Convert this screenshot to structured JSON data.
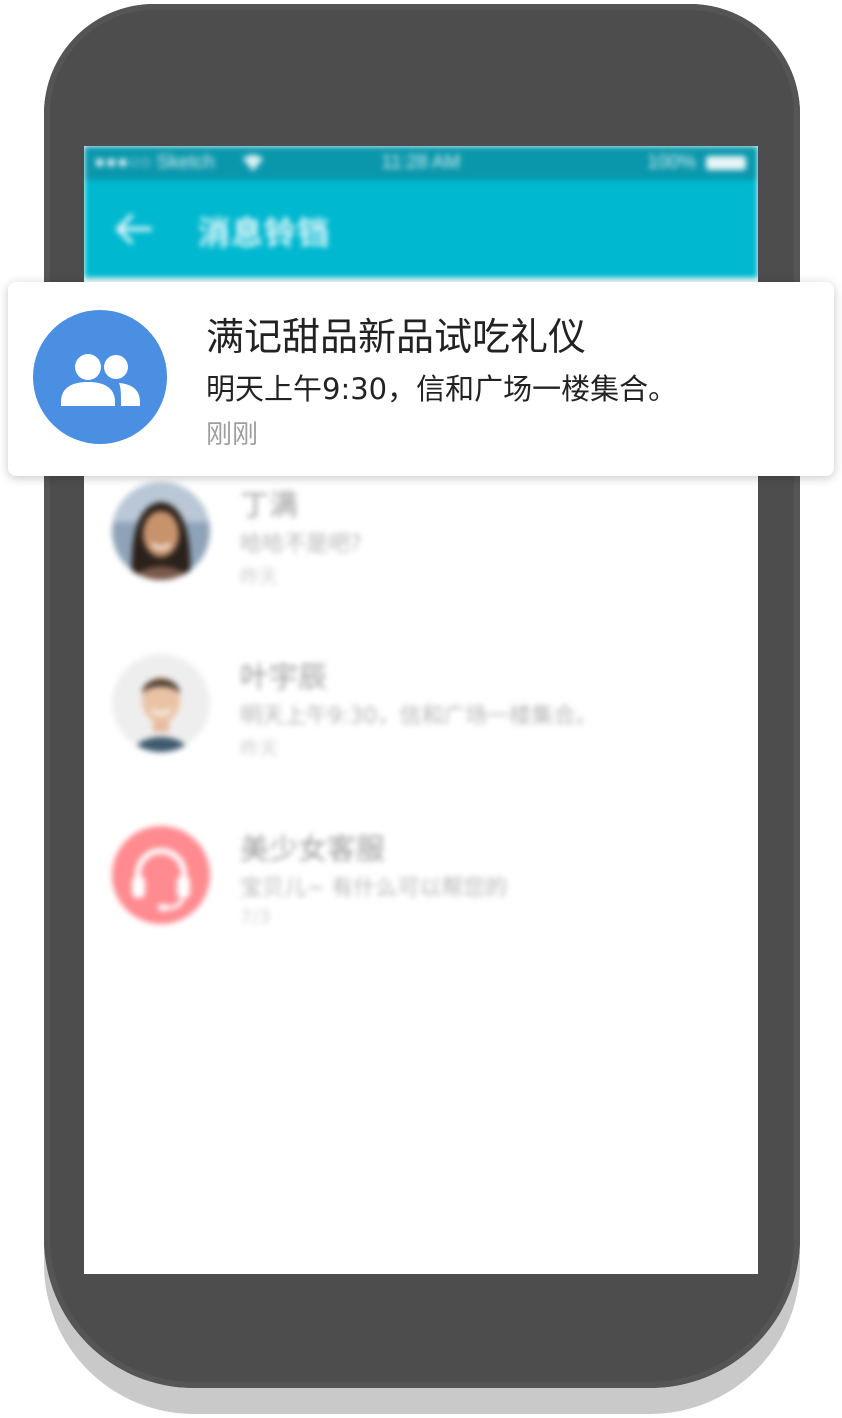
{
  "status_bar": {
    "carrier": "●●●○○ Sketch",
    "time": "11:28 AM",
    "battery": "100%"
  },
  "app_bar": {
    "title": "消息铃铛"
  },
  "notification": {
    "icon": "group-icon",
    "title": "满记甜品新品试吃礼仪",
    "body": "明天上午9:30，信和广场一楼集合。",
    "time": "刚刚"
  },
  "conversations": [
    {
      "name": "丁满",
      "message": "哈哈不是吧?",
      "time": "昨天",
      "avatar": "woman-photo"
    },
    {
      "name": "叶宇辰",
      "message": "明天上午9:30，信和广场一楼集合。",
      "time": "昨天",
      "avatar": "man-photo"
    },
    {
      "name": "美少女客服",
      "message": "宝贝儿~ 有什么可以帮您的",
      "time": "7/3",
      "avatar": "headset-icon"
    }
  ],
  "colors": {
    "phone_body": "#4d4d4d",
    "status_bar": "#0a97ac",
    "app_bar": "#00b8d0",
    "notification_icon_bg": "#4a8fe2",
    "service_avatar_bg": "#ff8a8f"
  }
}
